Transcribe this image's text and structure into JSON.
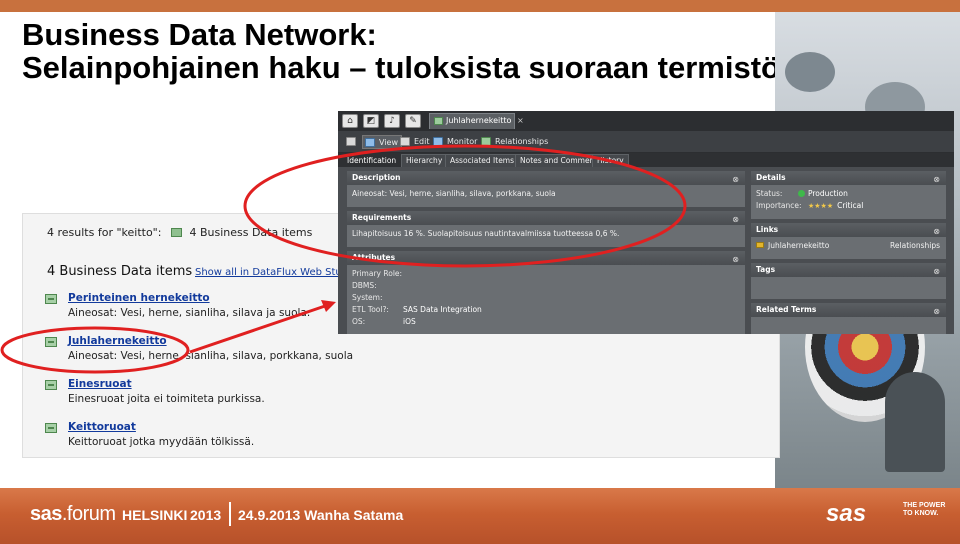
{
  "slide": {
    "title_line1": "Business Data Network:",
    "title_line2": "Selainpohjainen haku – tuloksista suoraan termistöön",
    "colors": {
      "accent": "#c8713e",
      "annotation": "#e02020",
      "link": "#123a9c"
    }
  },
  "search_results": {
    "count_text": "4 results for \"keitto\":",
    "count_badge": "4 Business Data items",
    "heading": "4 Business Data items",
    "show_all": "Show all in DataFlux Web Studio",
    "items": [
      {
        "name": "Perinteinen hernekeitto",
        "desc": "Aineosat: Vesi, herne, sianliha, silava ja suola."
      },
      {
        "name": "Juhlahernekeitto",
        "desc": "Aineosat: Vesi, herne, sianliha, silava, porkkana, suola"
      },
      {
        "name": "Einesruoat",
        "desc": "Einesruoat joita ei toimiteta purkissa."
      },
      {
        "name": "Keittoruoat",
        "desc": "Keittoruoat jotka myydään tölkissä."
      }
    ]
  },
  "app": {
    "doc_tab": "Juhlahernekeitto",
    "doc_tab_close": "×",
    "toolbar_icons": [
      "home-icon",
      "chart-icon",
      "bell-icon",
      "edit-doc-icon"
    ],
    "toolbar": {
      "view": "View",
      "edit": "Edit",
      "monitor": "Monitor",
      "relationships": "Relationships"
    },
    "tabs": [
      "Identification",
      "Hierarchy",
      "Associated Items",
      "Notes and Comments",
      "History"
    ],
    "description": {
      "title": "Description",
      "text": "Aineosat: Vesi, herne, sianliha, silava, porkkana, suola"
    },
    "requirements": {
      "title": "Requirements",
      "text": "Lihapitoisuus 16 %. Suolapitoisuus nautintavalmiissa tuotteessa 0,6 %."
    },
    "attributes": {
      "title": "Attributes",
      "rows": [
        {
          "key": "Primary Role:",
          "value": ""
        },
        {
          "key": "DBMS:",
          "value": ""
        },
        {
          "key": "System:",
          "value": ""
        },
        {
          "key": "ETL Tool?:",
          "value": "SAS Data Integration"
        },
        {
          "key": "OS:",
          "value": "iOS"
        }
      ]
    },
    "details": {
      "title": "Details",
      "status_label": "Status:",
      "status_value": "Production",
      "importance_label": "Importance:",
      "importance_stars": "★★★★",
      "importance_value": "Critical"
    },
    "links": {
      "title": "Links",
      "item": "Juhlahernekeitto",
      "type": "Relationships"
    },
    "tags": {
      "title": "Tags"
    },
    "related": {
      "title": "Related Terms"
    },
    "collapse_glyph": "⊗"
  },
  "footer": {
    "sas": "sas",
    "forum": ".forum",
    "city": "HELSINKI",
    "year": "2013",
    "event": "24.9.2013 Wanha Satama",
    "logo": "sas",
    "tagline": "THE POWER TO KNOW."
  }
}
